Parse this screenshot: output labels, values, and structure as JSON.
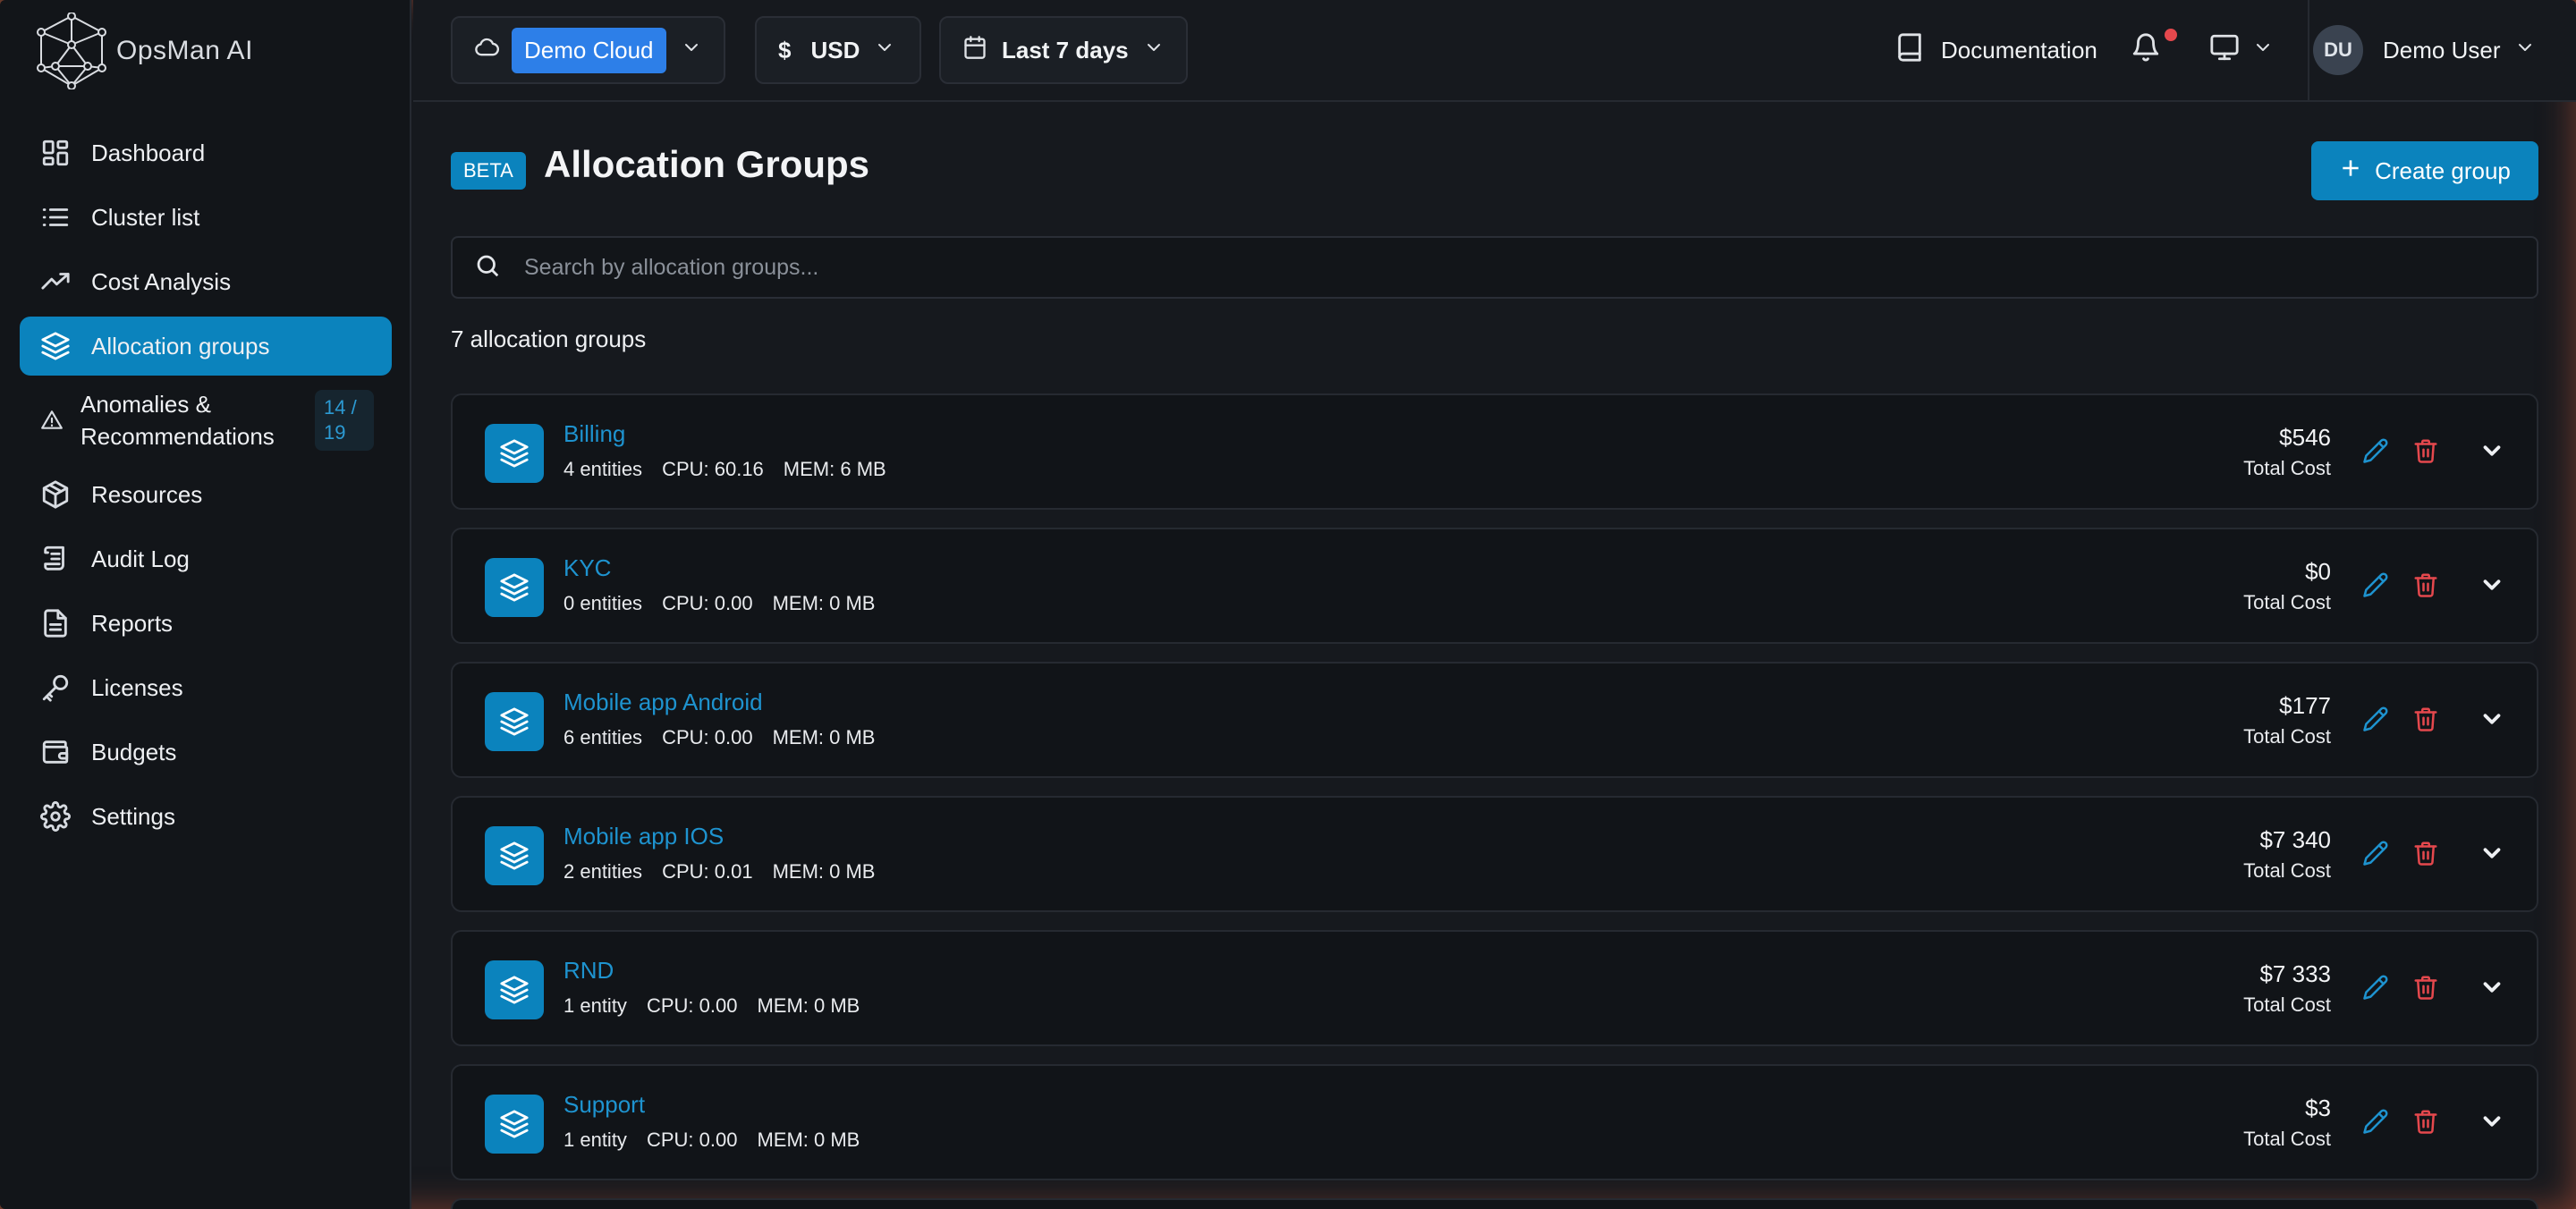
{
  "app": {
    "name": "OpsMan AI"
  },
  "sidebar": {
    "items": [
      {
        "label": "Dashboard",
        "icon": "dashboard-icon"
      },
      {
        "label": "Cluster list",
        "icon": "list-icon"
      },
      {
        "label": "Cost Analysis",
        "icon": "trending-up-icon"
      },
      {
        "label": "Allocation groups",
        "icon": "layers-icon",
        "active": true
      },
      {
        "label": "Anomalies & Recommendations",
        "icon": "warning-icon",
        "badge": "14 / 19"
      },
      {
        "label": "Resources",
        "icon": "box-icon"
      },
      {
        "label": "Audit Log",
        "icon": "scroll-icon"
      },
      {
        "label": "Reports",
        "icon": "report-icon"
      },
      {
        "label": "Licenses",
        "icon": "key-icon"
      },
      {
        "label": "Budgets",
        "icon": "wallet-icon"
      },
      {
        "label": "Settings",
        "icon": "gear-icon"
      }
    ]
  },
  "header": {
    "cloud": "Demo Cloud",
    "currency_symbol": "$",
    "currency": "USD",
    "date_range": "Last 7 days",
    "documentation": "Documentation",
    "user_initials": "DU",
    "user_name": "Demo User"
  },
  "page": {
    "badge": "BETA",
    "title": "Allocation Groups",
    "create_label": "Create group",
    "search_placeholder": "Search by allocation groups...",
    "count_text": "7 allocation groups"
  },
  "groups": [
    {
      "name": "Billing",
      "entities": "4 entities",
      "cpu": "CPU: 60.16",
      "mem": "MEM: 6 MB",
      "cost": "$546",
      "cost_label": "Total Cost"
    },
    {
      "name": "KYC",
      "entities": "0 entities",
      "cpu": "CPU: 0.00",
      "mem": "MEM: 0 MB",
      "cost": "$0",
      "cost_label": "Total Cost"
    },
    {
      "name": "Mobile app Android",
      "entities": "6 entities",
      "cpu": "CPU: 0.00",
      "mem": "MEM: 0 MB",
      "cost": "$177",
      "cost_label": "Total Cost"
    },
    {
      "name": "Mobile app IOS",
      "entities": "2 entities",
      "cpu": "CPU: 0.01",
      "mem": "MEM: 0 MB",
      "cost": "$7 340",
      "cost_label": "Total Cost"
    },
    {
      "name": "RND",
      "entities": "1 entity",
      "cpu": "CPU: 0.00",
      "mem": "MEM: 0 MB",
      "cost": "$7 333",
      "cost_label": "Total Cost"
    },
    {
      "name": "Support",
      "entities": "1 entity",
      "cpu": "CPU: 0.00",
      "mem": "MEM: 0 MB",
      "cost": "$3",
      "cost_label": "Total Cost"
    }
  ],
  "colors": {
    "accent": "#0b83bd",
    "danger": "#e5484d",
    "pill": "#2d7fe8"
  }
}
